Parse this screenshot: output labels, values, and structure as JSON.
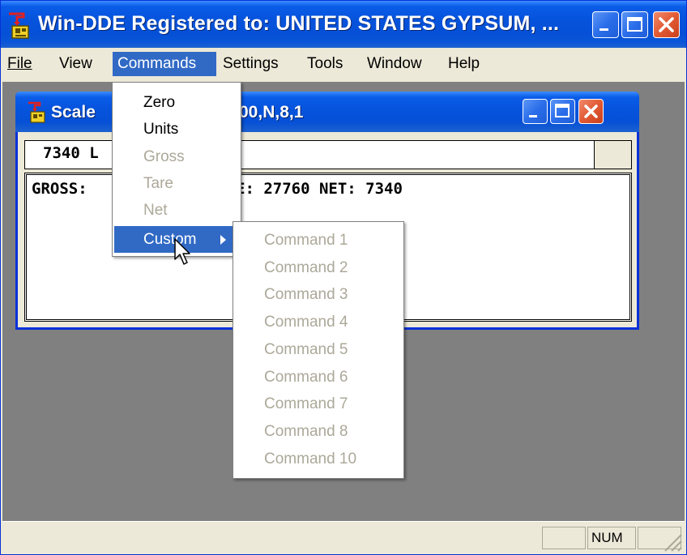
{
  "app": {
    "title": "Win-DDE  Registered to: UNITED STATES GYPSUM, ...",
    "accent_color": "#0a5ce8",
    "close_color": "#e25a34",
    "menu_highlight": "#316ac5"
  },
  "menubar": {
    "items": [
      "File",
      "View",
      "Commands",
      "Settings",
      "Tools",
      "Window",
      "Help"
    ],
    "active": "Commands"
  },
  "child_window": {
    "title_left": "Scale",
    "title_right": "00,N,8,1",
    "weight_display": "7340 L",
    "data_left": "GROSS:",
    "data_right": "E: 27760 NET: 7340"
  },
  "commands_menu": {
    "items": [
      {
        "label": "Zero",
        "enabled": true
      },
      {
        "label": "Units",
        "enabled": true
      },
      {
        "label": "Gross",
        "enabled": false
      },
      {
        "label": "Tare",
        "enabled": false
      },
      {
        "label": "Net",
        "enabled": false
      },
      {
        "label": "Custom",
        "enabled": true,
        "submenu": true
      }
    ]
  },
  "custom_submenu": {
    "items": [
      "Command 1",
      "Command 2",
      "Command 3",
      "Command 4",
      "Command 5",
      "Command 6",
      "Command 7",
      "Command 8",
      "Command 10"
    ]
  },
  "statusbar": {
    "num_indicator": "NUM"
  },
  "icons": [
    "app-icon",
    "minimize-icon",
    "maximize-icon",
    "close-icon",
    "submenu-arrow-icon",
    "mouse-cursor-icon",
    "resize-grip-icon"
  ]
}
